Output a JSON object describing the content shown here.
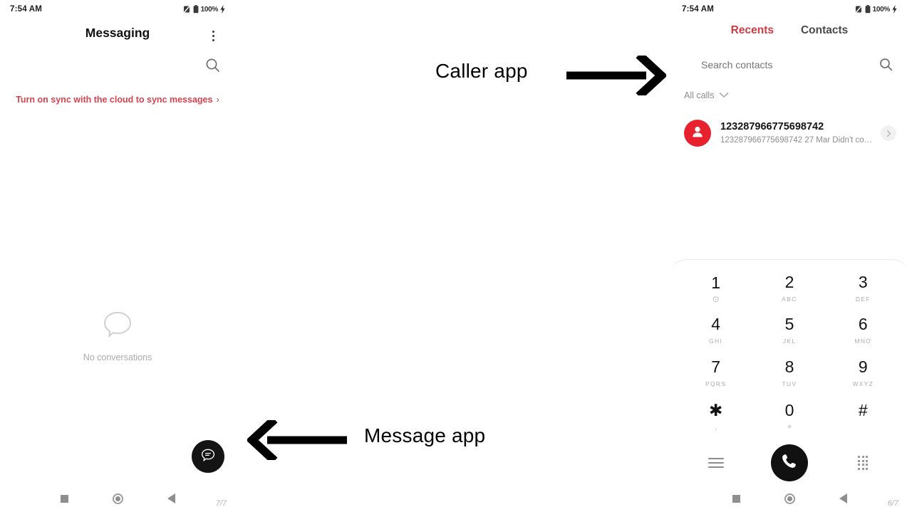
{
  "annotations": {
    "caller": "Caller app",
    "message": "Message app"
  },
  "left_phone": {
    "statusbar": {
      "time": "7:54 AM",
      "battery_pct": "100%",
      "icons": [
        "mute-icon",
        "battery-icon",
        "charging-bolt-icon"
      ]
    },
    "app_title": "Messaging",
    "menu_icon": "kebab-menu-icon",
    "search_icon": "search-icon",
    "sync_banner": {
      "text": "Turn on sync with the cloud to sync messages",
      "chevron": "›",
      "color": "#d9434f"
    },
    "empty_state": {
      "icon": "speech-bubble-icon",
      "label": "No conversations"
    },
    "fab": {
      "icon": "new-message-bubble-icon",
      "color": "#141414"
    },
    "navbar": {
      "recents_icon": "square-icon",
      "home_icon": "circle-icon",
      "back_icon": "triangle-back-icon",
      "page_indicator": "7/7"
    }
  },
  "right_phone": {
    "statusbar": {
      "time": "7:54 AM",
      "battery_pct": "100%",
      "icons": [
        "mute-icon",
        "battery-icon",
        "charging-bolt-icon"
      ]
    },
    "tabs": [
      {
        "label": "Recents",
        "active": true,
        "color": "#d03a44"
      },
      {
        "label": "Contacts",
        "active": false,
        "color": "#4a4a4a"
      }
    ],
    "search": {
      "placeholder": "Search contacts",
      "value": "",
      "icon": "search-icon"
    },
    "filter": {
      "label": "All calls",
      "icon": "chevron-down-icon"
    },
    "call_log": [
      {
        "name": "123287966775698742",
        "subtitle": "123287966775698742  27 Mar Didn't co…",
        "avatar_icon": "person-icon",
        "avatar_color": "#e8212e",
        "detail_icon": "chevron-right-icon"
      }
    ],
    "dialpad": {
      "keys": [
        {
          "digit": "1",
          "letters": "⊙",
          "is_symbol": true
        },
        {
          "digit": "2",
          "letters": "ABC",
          "is_symbol": false
        },
        {
          "digit": "3",
          "letters": "DEF",
          "is_symbol": false
        },
        {
          "digit": "4",
          "letters": "GHI",
          "is_symbol": false
        },
        {
          "digit": "5",
          "letters": "JKL",
          "is_symbol": false
        },
        {
          "digit": "6",
          "letters": "MNO",
          "is_symbol": false
        },
        {
          "digit": "7",
          "letters": "PQRS",
          "is_symbol": false
        },
        {
          "digit": "8",
          "letters": "TUV",
          "is_symbol": false
        },
        {
          "digit": "9",
          "letters": "WXYZ",
          "is_symbol": false
        },
        {
          "digit": "✱",
          "letters": ",",
          "is_symbol": true
        },
        {
          "digit": "0",
          "letters": "+",
          "is_symbol": true
        },
        {
          "digit": "#",
          "letters": "",
          "is_symbol": true
        }
      ],
      "actions": {
        "left_icon": "menu-list-icon",
        "call_icon": "phone-call-icon",
        "call_color": "#111111",
        "right_icon": "keypad-grid-icon"
      }
    },
    "navbar": {
      "recents_icon": "square-icon",
      "home_icon": "circle-icon",
      "back_icon": "triangle-back-icon",
      "page_indicator": "6/7"
    }
  }
}
